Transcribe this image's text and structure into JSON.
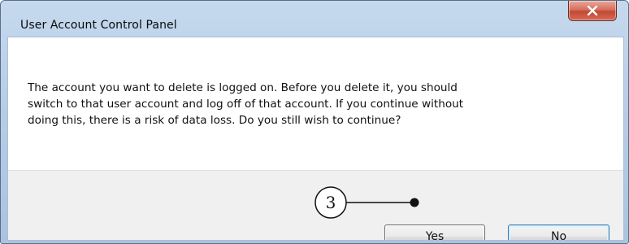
{
  "window": {
    "title": "User Account Control Panel"
  },
  "title_bar": {
    "close_icon": "close-icon"
  },
  "message": {
    "lines": [
      "The account you want to delete is logged on.  Before you delete it, you should",
      "switch to that user account and log off of that account.  If you continue without",
      "doing this, there is a risk of data loss.  Do you still wish to continue?"
    ]
  },
  "buttons": {
    "yes_label": "Yes",
    "no_label": "No"
  },
  "annotation": {
    "callout_number": "3"
  },
  "colors": {
    "frame": "#b7cde6",
    "close_button": "#c24a35",
    "default_button_border": "#3c7fb1"
  }
}
